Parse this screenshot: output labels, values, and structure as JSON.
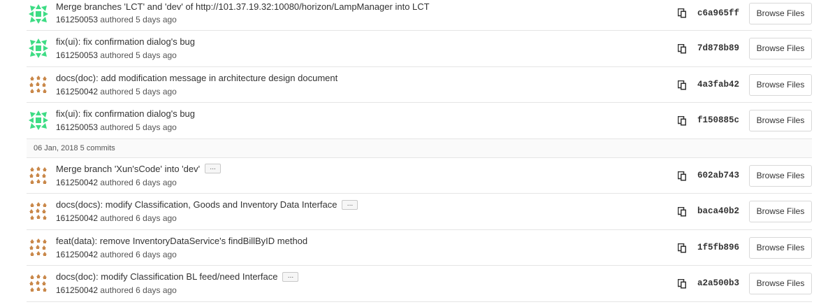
{
  "colors": {
    "avatar_green": "#3ddc84",
    "avatar_orange": "#c9884a",
    "border": "#e5e5e5",
    "header_bg": "#fafafa"
  },
  "icons": {
    "copy": "clipboard-icon",
    "more": "ellipsis-icon"
  },
  "browse_label": "Browse Files",
  "ellipsis_label": "...",
  "groups": [
    {
      "header": "",
      "commits": [
        {
          "title": "Merge branches 'LCT' and 'dev' of http://101.37.19.32:10080/horizon/LampManager into LCT",
          "author": "161250053",
          "authored": "authored",
          "when": "5 days ago",
          "sha": "c6a965ff",
          "avatar": "green",
          "more": false
        },
        {
          "title": "fix(ui): fix confirmation dialog's bug",
          "author": "161250053",
          "authored": "authored",
          "when": "5 days ago",
          "sha": "7d878b89",
          "avatar": "green",
          "more": false
        },
        {
          "title": "docs(doc): add modification message in architecture design document",
          "author": "161250042",
          "authored": "authored",
          "when": "5 days ago",
          "sha": "4a3fab42",
          "avatar": "orange",
          "more": false
        },
        {
          "title": "fix(ui): fix confirmation dialog's bug",
          "author": "161250053",
          "authored": "authored",
          "when": "5 days ago",
          "sha": "f150885c",
          "avatar": "green",
          "more": false
        }
      ]
    },
    {
      "header": "06 Jan, 2018 5 commits",
      "commits": [
        {
          "title": "Merge branch 'Xun'sCode' into 'dev'",
          "author": "161250042",
          "authored": "authored",
          "when": "6 days ago",
          "sha": "602ab743",
          "avatar": "orange",
          "more": true
        },
        {
          "title": "docs(docs): modify Classification, Goods and Inventory Data Interface",
          "author": "161250042",
          "authored": "authored",
          "when": "6 days ago",
          "sha": "baca40b2",
          "avatar": "orange",
          "more": true
        },
        {
          "title": "feat(data): remove InventoryDataService's findBillByID method",
          "author": "161250042",
          "authored": "authored",
          "when": "6 days ago",
          "sha": "1f5fb896",
          "avatar": "orange",
          "more": false
        },
        {
          "title": "docs(doc): modify Classification BL feed/need Interface",
          "author": "161250042",
          "authored": "authored",
          "when": "6 days ago",
          "sha": "a2a500b3",
          "avatar": "orange",
          "more": true
        }
      ]
    }
  ]
}
